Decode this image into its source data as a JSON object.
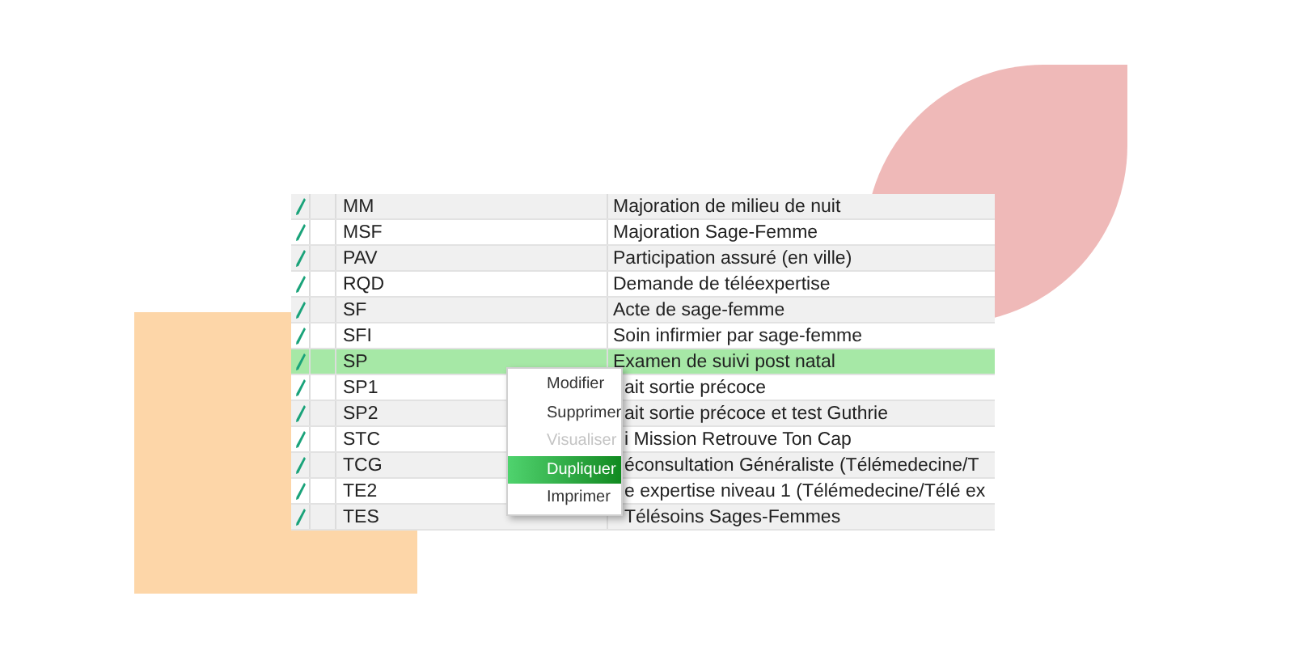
{
  "table": {
    "rows": [
      {
        "code": "MM",
        "description": "Majoration de milieu de nuit",
        "selected": false,
        "covered": false
      },
      {
        "code": "MSF",
        "description": "Majoration Sage-Femme",
        "selected": false,
        "covered": false
      },
      {
        "code": "PAV",
        "description": "Participation assuré (en ville)",
        "selected": false,
        "covered": false
      },
      {
        "code": "RQD",
        "description": "Demande de téléexpertise",
        "selected": false,
        "covered": false
      },
      {
        "code": "SF",
        "description": "Acte de sage-femme",
        "selected": false,
        "covered": false
      },
      {
        "code": "SFI",
        "description": "Soin infirmier par sage-femme",
        "selected": false,
        "covered": false
      },
      {
        "code": "SP",
        "description": "Examen de suivi post natal",
        "selected": true,
        "covered": false
      },
      {
        "code": "SP1",
        "description": "ait sortie précoce",
        "selected": false,
        "covered": true
      },
      {
        "code": "SP2",
        "description": "ait sortie précoce et test Guthrie",
        "selected": false,
        "covered": true
      },
      {
        "code": "STC",
        "description": "i Mission Retrouve Ton Cap",
        "selected": false,
        "covered": true
      },
      {
        "code": "TCG",
        "description": "éconsultation Généraliste (Télémedecine/T",
        "selected": false,
        "covered": true
      },
      {
        "code": "TE2",
        "description": "e expertise niveau 1 (Télémedecine/Télé ex",
        "selected": false,
        "covered": true
      },
      {
        "code": "TES",
        "description": "Télésoins Sages-Femmes",
        "selected": false,
        "covered": true
      }
    ]
  },
  "context_menu": {
    "items": [
      {
        "label": "Modifier",
        "disabled": false,
        "selected": false
      },
      {
        "label": "Supprimer",
        "disabled": false,
        "selected": false
      },
      {
        "label": "Visualiser",
        "disabled": true,
        "selected": false
      },
      {
        "label": "Dupliquer",
        "disabled": false,
        "selected": true
      },
      {
        "label": "Imprimer",
        "disabled": false,
        "selected": false
      }
    ]
  }
}
